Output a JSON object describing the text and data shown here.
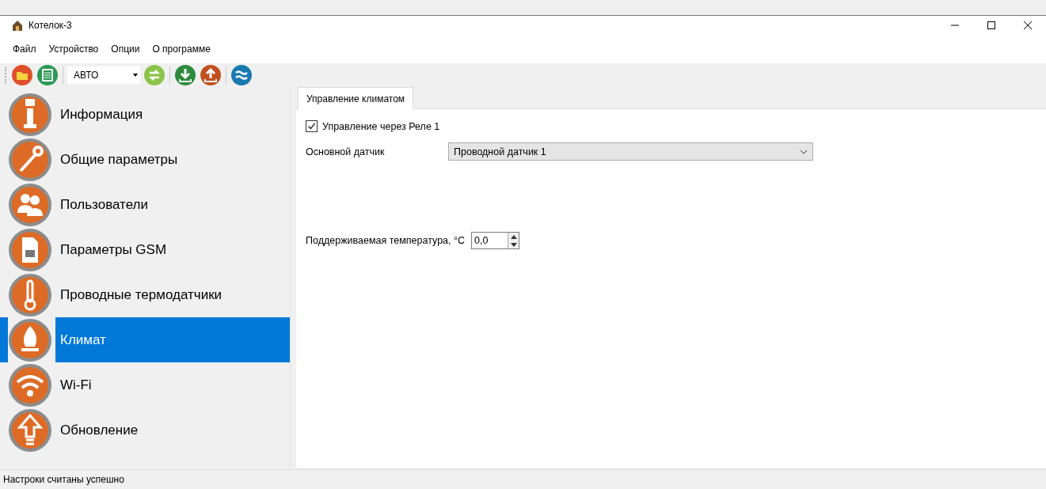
{
  "window": {
    "title": "Котелок-3"
  },
  "menu": [
    "Файл",
    "Устройство",
    "Опции",
    "О программе"
  ],
  "toolbar": {
    "mode_combo": "АВТО"
  },
  "sidebar": {
    "items": [
      {
        "label": "Информация",
        "selected": false
      },
      {
        "label": "Общие параметры",
        "selected": false
      },
      {
        "label": "Пользователи",
        "selected": false
      },
      {
        "label": "Параметры GSM",
        "selected": false
      },
      {
        "label": "Проводные термодатчики",
        "selected": false
      },
      {
        "label": "Климат",
        "selected": true
      },
      {
        "label": "Wi-Fi",
        "selected": false
      },
      {
        "label": "Обновление",
        "selected": false
      }
    ]
  },
  "tabs": [
    {
      "label": "Управление климатом",
      "selected": true
    }
  ],
  "relay_control": {
    "label": "Управление через Реле 1",
    "checked": true
  },
  "main_sensor": {
    "label": "Основной датчик",
    "value": "Проводной датчик 1"
  },
  "target_temperature": {
    "label": "Поддерживаемая температура, °C",
    "value": "0,0"
  },
  "status_bar": {
    "text": "Настроки считаны успешно"
  }
}
